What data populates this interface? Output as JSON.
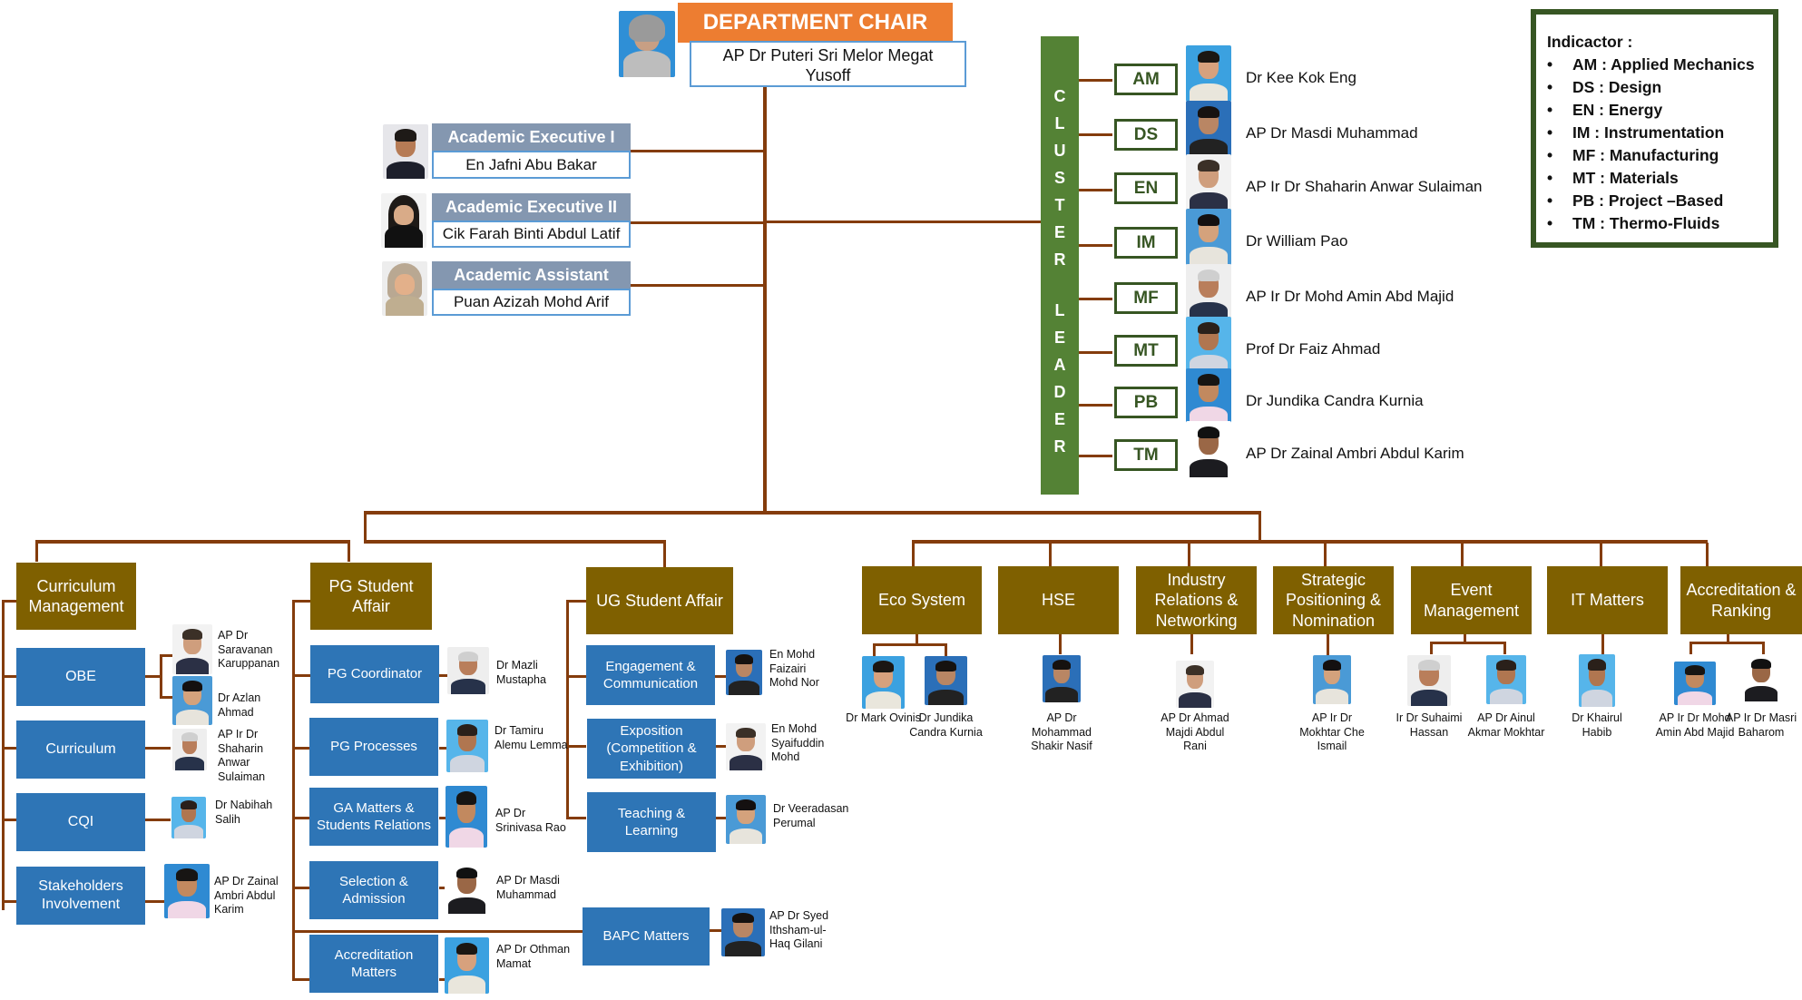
{
  "chair": {
    "title": "DEPARTMENT CHAIR",
    "name_line1": "AP Dr Puteri Sri Melor Megat",
    "name_line2": "Yusoff",
    "header_color": "#ed7d31"
  },
  "staff": [
    {
      "role": "Academic Executive I",
      "name": "En Jafni Abu Bakar"
    },
    {
      "role": "Academic Executive II",
      "name": "Cik Farah Binti Abdul Latif"
    },
    {
      "role": "Academic Assistant",
      "name": "Puan Azizah Mohd Arif"
    }
  ],
  "cluster": {
    "label_letters_1": [
      "C",
      "L",
      "U",
      "S",
      "T",
      "E",
      "R"
    ],
    "label_letters_2": [
      "L",
      "E",
      "A",
      "D",
      "E",
      "R"
    ],
    "bar_color": "#548235",
    "leaders": [
      {
        "code": "AM",
        "name": "Dr Kee Kok Eng"
      },
      {
        "code": "DS",
        "name": "AP Dr Masdi Muhammad"
      },
      {
        "code": "EN",
        "name": "AP Ir Dr Shaharin Anwar Sulaiman"
      },
      {
        "code": "IM",
        "name": "Dr William Pao"
      },
      {
        "code": "MF",
        "name": "AP Ir Dr Mohd Amin Abd Majid"
      },
      {
        "code": "MT",
        "name": "Prof Dr Faiz Ahmad"
      },
      {
        "code": "PB",
        "name": "Dr Jundika Candra Kurnia"
      },
      {
        "code": "TM",
        "name": "AP Dr Zainal Ambri Abdul Karim"
      }
    ]
  },
  "indicator": {
    "title": "Indicactor :",
    "items": [
      "AM : Applied Mechanics",
      "DS : Design",
      "EN : Energy",
      "IM : Instrumentation",
      "MF : Manufacturing",
      "MT : Materials",
      "PB : Project –Based",
      "TM : Thermo-Fluids"
    ]
  },
  "curriculum": {
    "title": "Curriculum Management",
    "units": [
      {
        "label": "OBE",
        "people": [
          "AP Dr Saravanan Karuppanan",
          "Dr Azlan Ahmad"
        ]
      },
      {
        "label": "Curriculum",
        "people": [
          "AP Ir Dr Shaharin Anwar Sulaiman"
        ]
      },
      {
        "label": "CQI",
        "people": [
          "Dr Nabihah Salih"
        ]
      },
      {
        "label": "Stakeholders Involvement",
        "people": [
          "AP Dr Zainal Ambri Abdul Karim"
        ]
      }
    ]
  },
  "pg": {
    "title": "PG Student Affair",
    "units": [
      {
        "label": "PG Coordinator",
        "person": "Dr Mazli Mustapha"
      },
      {
        "label": "PG Processes",
        "person": "Dr Tamiru Alemu Lemma"
      },
      {
        "label": "GA Matters & Students Relations",
        "person": "AP Dr Srinivasa Rao"
      },
      {
        "label": "Selection & Admission",
        "person": "AP Dr Masdi Muhammad"
      },
      {
        "label": "Accreditation Matters",
        "person": "AP Dr Othman Mamat"
      },
      {
        "label": "BAPC Matters",
        "person": "AP Dr Syed Ithsham-ul-Haq Gilani"
      }
    ]
  },
  "ug": {
    "title": "UG Student Affair",
    "units": [
      {
        "label": "Engagement & Communication",
        "person": "En Mohd Faizairi Mohd Nor"
      },
      {
        "label": "Exposition (Competition & Exhibition)",
        "person": "En Mohd Syaifuddin Mohd"
      },
      {
        "label": "Teaching & Learning",
        "person": "Dr Veeradasan Perumal"
      }
    ]
  },
  "committees": [
    {
      "label": "Eco System",
      "people": [
        "Dr Mark Ovinis",
        "Dr Jundika Candra Kurnia"
      ]
    },
    {
      "label": "HSE",
      "people": [
        "AP Dr Mohammad Shakir Nasif"
      ]
    },
    {
      "label": "Industry Relations & Networking",
      "people": [
        "AP Dr Ahmad Majdi Abdul Rani"
      ]
    },
    {
      "label": "Strategic Positioning & Nomination",
      "people": [
        "AP Ir Dr Mokhtar Che Ismail"
      ]
    },
    {
      "label": "Event Management",
      "people": [
        "Ir Dr Suhaimi Hassan",
        "AP Dr Ainul Akmar Mokhtar"
      ]
    },
    {
      "label": "IT Matters",
      "people": [
        "Dr Khairul Habib"
      ]
    },
    {
      "label": "Accreditation & Ranking",
      "people": [
        "AP Ir Dr Mohd Amin Abd Majid",
        "AP Ir Dr Masri Baharom"
      ]
    }
  ],
  "colors": {
    "connector": "#843c0c",
    "committee_box": "#7f6000",
    "unit_box": "#2e75b6",
    "staff_header": "#8497b0",
    "name_border": "#5b9bd5",
    "indicator_border": "#375623"
  }
}
